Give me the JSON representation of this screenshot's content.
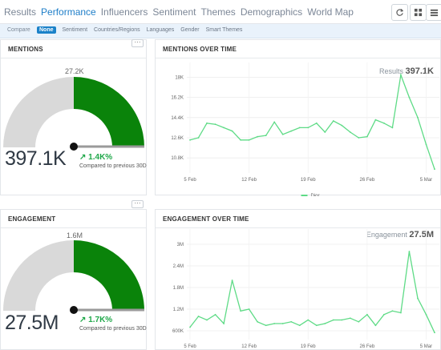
{
  "nav": {
    "tabs": [
      "Results",
      "Performance",
      "Influencers",
      "Sentiment",
      "Themes",
      "Demographics",
      "World Map"
    ],
    "active_index": 1,
    "buttons": [
      "refresh-icon",
      "grid-view-icon",
      "list-view-icon"
    ]
  },
  "compare": {
    "label": "Compare",
    "options": [
      "None",
      "Sentiment",
      "Countries/Regions",
      "Languages",
      "Gender",
      "Smart Themes"
    ],
    "active_index": 0
  },
  "colors": {
    "accent": "#1e7ec8",
    "gauge_fill": "#0a830a",
    "gauge_empty": "#d9d9d9",
    "line": "#5edb86",
    "positive": "#20a84a"
  },
  "mentions": {
    "title": "MENTIONS",
    "max": "27.2K",
    "value": "397.1K",
    "change": "1.4K%",
    "compare_text": "Compared to previous 30D",
    "gauge_fraction": 0.5
  },
  "mentions_over_time": {
    "title": "MENTIONS OVER TIME",
    "results_label": "Results",
    "results_value": "397.1K",
    "legend": "Dior",
    "chart_data": {
      "type": "line",
      "title": "MENTIONS OVER TIME",
      "y_ticks": [
        "10.8K",
        "12.6K",
        "14.4K",
        "16.2K",
        "18K"
      ],
      "x_ticks": [
        "5 Feb",
        "12 Feb",
        "19 Feb",
        "26 Feb",
        "5 Mar"
      ],
      "series": [
        {
          "name": "Dior",
          "x": [
            0,
            1,
            2,
            3,
            4,
            5,
            6,
            7,
            8,
            9,
            10,
            11,
            12,
            13,
            14,
            15,
            16,
            17,
            18,
            19,
            20,
            21,
            22,
            23,
            24,
            25,
            26,
            27,
            28,
            29
          ],
          "values": [
            12400,
            12600,
            13900,
            13800,
            13500,
            13200,
            12400,
            12400,
            12700,
            12800,
            14000,
            12900,
            13200,
            13500,
            13500,
            13900,
            13100,
            14100,
            13700,
            13100,
            12600,
            12700,
            14200,
            13900,
            13500,
            18200,
            16200,
            14400,
            12000,
            9800
          ]
        }
      ],
      "ylim": [
        9600,
        18600
      ],
      "grid": true,
      "legend_position": "bottom"
    }
  },
  "engagement": {
    "title": "ENGAGEMENT",
    "max": "1.6M",
    "value": "27.5M",
    "change": "1.7K%",
    "compare_text": "Compared to previous 30D",
    "gauge_fraction": 0.5
  },
  "engagement_over_time": {
    "title": "ENGAGEMENT OVER TIME",
    "results_label": "Engagement",
    "results_value": "27.5M",
    "chart_data": {
      "type": "line",
      "title": "ENGAGEMENT OVER TIME",
      "y_ticks": [
        "600K",
        "1.2M",
        "1.8M",
        "2.4M",
        "3M"
      ],
      "x_ticks": [
        "5 Feb",
        "12 Feb",
        "19 Feb",
        "26 Feb",
        "5 Mar"
      ],
      "series": [
        {
          "name": "Dior",
          "x": [
            0,
            1,
            2,
            3,
            4,
            5,
            6,
            7,
            8,
            9,
            10,
            11,
            12,
            13,
            14,
            15,
            16,
            17,
            18,
            19,
            20,
            21,
            22,
            23,
            24,
            25,
            26,
            27,
            28,
            29
          ],
          "values": [
            700000,
            1000000,
            900000,
            1050000,
            800000,
            2000000,
            1150000,
            1200000,
            850000,
            750000,
            800000,
            800000,
            850000,
            750000,
            900000,
            750000,
            800000,
            900000,
            900000,
            950000,
            850000,
            1050000,
            750000,
            1050000,
            1150000,
            1100000,
            2800000,
            1500000,
            1050000,
            550000
          ]
        }
      ],
      "ylim": [
        400000,
        3200000
      ],
      "grid": true
    }
  }
}
